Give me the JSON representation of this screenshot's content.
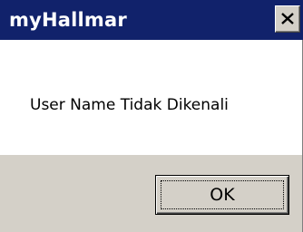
{
  "window": {
    "title": "myHallmar",
    "close_icon": "close-x-icon"
  },
  "dialog": {
    "message": "User Name Tidak Dikenali",
    "ok_label": "OK"
  },
  "colors": {
    "titlebar": "#11226b",
    "title_text": "#ffffff",
    "footer": "#d4d0c8",
    "content": "#ffffff"
  }
}
